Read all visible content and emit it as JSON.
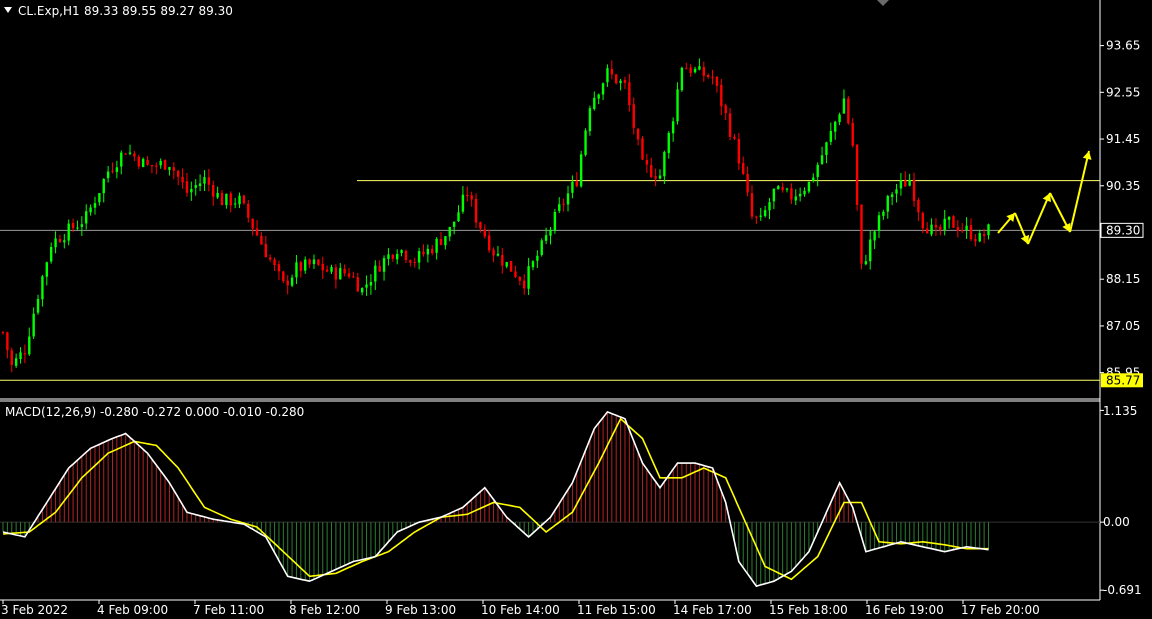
{
  "header": {
    "symbol_label": "CL.Exp,H1",
    "ohlc_text": "89.33 89.55 89.27 89.30",
    "macd_label": "MACD(12,26,9) -0.280 -0.272 0.000 -0.010 -0.280"
  },
  "price_axis": {
    "ticks": [
      "93.65",
      "92.55",
      "91.45",
      "90.35",
      "89.30",
      "88.15",
      "87.05",
      "85.95"
    ],
    "current_price": "89.30",
    "support_price": "85.77"
  },
  "macd_axis": {
    "ticks": [
      "1.135",
      "0.00",
      "-0.691"
    ]
  },
  "time_axis": {
    "labels": [
      "3 Feb 2022",
      "4 Feb 09:00",
      "7 Feb 11:00",
      "8 Feb 12:00",
      "9 Feb 13:00",
      "10 Feb 14:00",
      "11 Feb 15:00",
      "14 Feb 17:00",
      "15 Feb 18:00",
      "16 Feb 19:00",
      "17 Feb 20:00"
    ]
  },
  "colors": {
    "background": "#000000",
    "bull": "#00ff00",
    "bear": "#ff0000",
    "macd_line": "#ffffff",
    "signal_line": "#ffff00",
    "hist_pos": "#b22222",
    "hist_neg": "#2e7d32",
    "level_line": "#ffff66",
    "forecast_arrow": "#ffff00"
  },
  "chart_data": [
    {
      "type": "candlestick",
      "title": "CL.Exp,H1",
      "ylim": [
        85.4,
        94.3
      ],
      "horizontal_lines": [
        90.47,
        89.3,
        85.77
      ],
      "close_path": [
        {
          "t": 0,
          "v": 86.9
        },
        {
          "t": 2,
          "v": 86.1
        },
        {
          "t": 5,
          "v": 86.5
        },
        {
          "t": 8,
          "v": 87.8
        },
        {
          "t": 11,
          "v": 89.0
        },
        {
          "t": 15,
          "v": 89.3
        },
        {
          "t": 19,
          "v": 89.6
        },
        {
          "t": 24,
          "v": 90.7
        },
        {
          "t": 28,
          "v": 91.2
        },
        {
          "t": 33,
          "v": 90.8
        },
        {
          "t": 38,
          "v": 90.9
        },
        {
          "t": 42,
          "v": 90.2
        },
        {
          "t": 46,
          "v": 90.5
        },
        {
          "t": 50,
          "v": 90.0
        },
        {
          "t": 54,
          "v": 90.0
        },
        {
          "t": 58,
          "v": 89.2
        },
        {
          "t": 61,
          "v": 88.6
        },
        {
          "t": 64,
          "v": 88.0
        },
        {
          "t": 67,
          "v": 88.4
        },
        {
          "t": 71,
          "v": 88.5
        },
        {
          "t": 75,
          "v": 88.3
        },
        {
          "t": 79,
          "v": 88.3
        },
        {
          "t": 82,
          "v": 87.9
        },
        {
          "t": 86,
          "v": 88.5
        },
        {
          "t": 90,
          "v": 88.9
        },
        {
          "t": 94,
          "v": 88.6
        },
        {
          "t": 98,
          "v": 88.9
        },
        {
          "t": 102,
          "v": 89.3
        },
        {
          "t": 106,
          "v": 90.2
        },
        {
          "t": 108,
          "v": 89.6
        },
        {
          "t": 112,
          "v": 88.8
        },
        {
          "t": 116,
          "v": 88.4
        },
        {
          "t": 119,
          "v": 88.1
        },
        {
          "t": 123,
          "v": 88.9
        },
        {
          "t": 127,
          "v": 89.8
        },
        {
          "t": 131,
          "v": 90.5
        },
        {
          "t": 134,
          "v": 92.3
        },
        {
          "t": 138,
          "v": 93.0
        },
        {
          "t": 142,
          "v": 92.7
        },
        {
          "t": 146,
          "v": 90.8
        },
        {
          "t": 150,
          "v": 90.6
        },
        {
          "t": 153,
          "v": 92.0
        },
        {
          "t": 155,
          "v": 93.2
        },
        {
          "t": 159,
          "v": 93.0
        },
        {
          "t": 162,
          "v": 92.9
        },
        {
          "t": 165,
          "v": 92.0
        },
        {
          "t": 168,
          "v": 91.0
        },
        {
          "t": 171,
          "v": 89.6
        },
        {
          "t": 173,
          "v": 89.5
        },
        {
          "t": 176,
          "v": 90.2
        },
        {
          "t": 180,
          "v": 90.1
        },
        {
          "t": 184,
          "v": 90.4
        },
        {
          "t": 188,
          "v": 91.3
        },
        {
          "t": 192,
          "v": 92.4
        },
        {
          "t": 194,
          "v": 91.3
        },
        {
          "t": 196,
          "v": 88.4
        },
        {
          "t": 199,
          "v": 89.3
        },
        {
          "t": 203,
          "v": 90.2
        },
        {
          "t": 207,
          "v": 90.5
        },
        {
          "t": 210,
          "v": 89.5
        },
        {
          "t": 213,
          "v": 89.2
        },
        {
          "t": 216,
          "v": 89.5
        },
        {
          "t": 220,
          "v": 89.3
        },
        {
          "t": 223,
          "v": 89.1
        },
        {
          "t": 225,
          "v": 89.3
        }
      ]
    },
    {
      "type": "line",
      "title": "MACD(12,26,9)",
      "ylim": [
        -0.75,
        1.2
      ],
      "zero_line": 0.0,
      "series": [
        {
          "name": "macd",
          "points": [
            {
              "t": 0,
              "v": -0.1
            },
            {
              "t": 5,
              "v": -0.15
            },
            {
              "t": 10,
              "v": 0.2
            },
            {
              "t": 15,
              "v": 0.55
            },
            {
              "t": 20,
              "v": 0.75
            },
            {
              "t": 25,
              "v": 0.85
            },
            {
              "t": 28,
              "v": 0.9
            },
            {
              "t": 33,
              "v": 0.7
            },
            {
              "t": 38,
              "v": 0.4
            },
            {
              "t": 42,
              "v": 0.1
            },
            {
              "t": 48,
              "v": 0.03
            },
            {
              "t": 55,
              "v": -0.02
            },
            {
              "t": 60,
              "v": -0.15
            },
            {
              "t": 65,
              "v": -0.55
            },
            {
              "t": 70,
              "v": -0.6
            },
            {
              "t": 75,
              "v": -0.5
            },
            {
              "t": 80,
              "v": -0.4
            },
            {
              "t": 85,
              "v": -0.35
            },
            {
              "t": 90,
              "v": -0.1
            },
            {
              "t": 95,
              "v": 0.0
            },
            {
              "t": 100,
              "v": 0.05
            },
            {
              "t": 105,
              "v": 0.15
            },
            {
              "t": 110,
              "v": 0.35
            },
            {
              "t": 115,
              "v": 0.05
            },
            {
              "t": 120,
              "v": -0.15
            },
            {
              "t": 125,
              "v": 0.05
            },
            {
              "t": 130,
              "v": 0.4
            },
            {
              "t": 135,
              "v": 0.95
            },
            {
              "t": 138,
              "v": 1.12
            },
            {
              "t": 142,
              "v": 1.05
            },
            {
              "t": 146,
              "v": 0.6
            },
            {
              "t": 150,
              "v": 0.35
            },
            {
              "t": 154,
              "v": 0.6
            },
            {
              "t": 158,
              "v": 0.6
            },
            {
              "t": 162,
              "v": 0.55
            },
            {
              "t": 165,
              "v": 0.2
            },
            {
              "t": 168,
              "v": -0.4
            },
            {
              "t": 172,
              "v": -0.65
            },
            {
              "t": 176,
              "v": -0.6
            },
            {
              "t": 180,
              "v": -0.5
            },
            {
              "t": 184,
              "v": -0.3
            },
            {
              "t": 188,
              "v": 0.1
            },
            {
              "t": 191,
              "v": 0.4
            },
            {
              "t": 194,
              "v": 0.15
            },
            {
              "t": 197,
              "v": -0.3
            },
            {
              "t": 201,
              "v": -0.25
            },
            {
              "t": 205,
              "v": -0.2
            },
            {
              "t": 210,
              "v": -0.25
            },
            {
              "t": 215,
              "v": -0.3
            },
            {
              "t": 220,
              "v": -0.25
            },
            {
              "t": 225,
              "v": -0.28
            }
          ]
        },
        {
          "name": "signal",
          "points": [
            {
              "t": 0,
              "v": -0.12
            },
            {
              "t": 6,
              "v": -0.1
            },
            {
              "t": 12,
              "v": 0.1
            },
            {
              "t": 18,
              "v": 0.45
            },
            {
              "t": 24,
              "v": 0.7
            },
            {
              "t": 30,
              "v": 0.82
            },
            {
              "t": 35,
              "v": 0.78
            },
            {
              "t": 40,
              "v": 0.55
            },
            {
              "t": 46,
              "v": 0.15
            },
            {
              "t": 52,
              "v": 0.03
            },
            {
              "t": 58,
              "v": -0.05
            },
            {
              "t": 64,
              "v": -0.3
            },
            {
              "t": 70,
              "v": -0.55
            },
            {
              "t": 76,
              "v": -0.52
            },
            {
              "t": 82,
              "v": -0.4
            },
            {
              "t": 88,
              "v": -0.3
            },
            {
              "t": 94,
              "v": -0.1
            },
            {
              "t": 100,
              "v": 0.05
            },
            {
              "t": 106,
              "v": 0.08
            },
            {
              "t": 112,
              "v": 0.2
            },
            {
              "t": 118,
              "v": 0.15
            },
            {
              "t": 124,
              "v": -0.1
            },
            {
              "t": 130,
              "v": 0.1
            },
            {
              "t": 136,
              "v": 0.6
            },
            {
              "t": 141,
              "v": 1.05
            },
            {
              "t": 146,
              "v": 0.85
            },
            {
              "t": 150,
              "v": 0.45
            },
            {
              "t": 155,
              "v": 0.45
            },
            {
              "t": 160,
              "v": 0.55
            },
            {
              "t": 165,
              "v": 0.45
            },
            {
              "t": 170,
              "v": -0.05
            },
            {
              "t": 174,
              "v": -0.45
            },
            {
              "t": 180,
              "v": -0.58
            },
            {
              "t": 186,
              "v": -0.35
            },
            {
              "t": 192,
              "v": 0.2
            },
            {
              "t": 196,
              "v": 0.2
            },
            {
              "t": 200,
              "v": -0.2
            },
            {
              "t": 205,
              "v": -0.22
            },
            {
              "t": 210,
              "v": -0.2
            },
            {
              "t": 215,
              "v": -0.23
            },
            {
              "t": 220,
              "v": -0.27
            },
            {
              "t": 225,
              "v": -0.27
            }
          ]
        }
      ]
    }
  ]
}
